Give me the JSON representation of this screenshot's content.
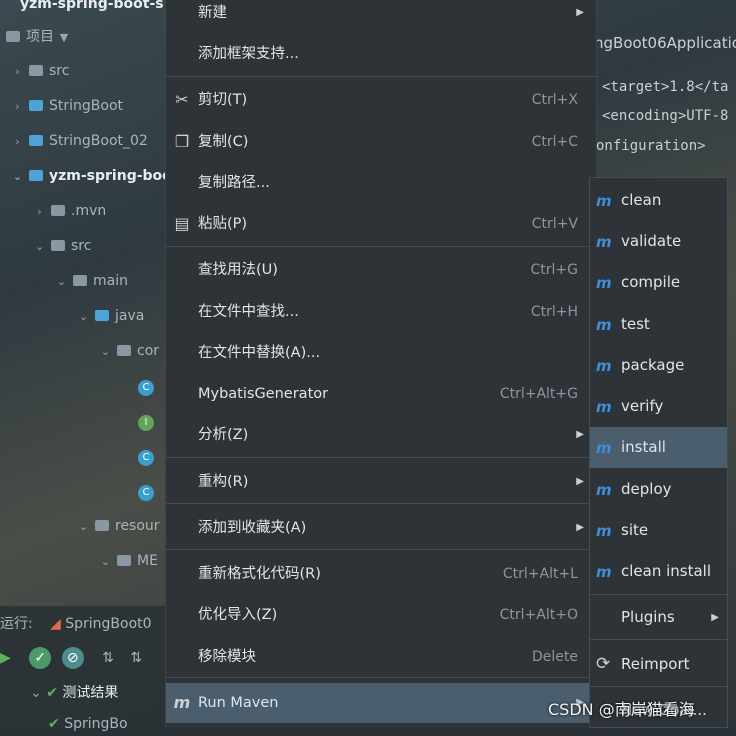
{
  "project_tree": {
    "header_title": "yzm-spring-boot-s",
    "view_label": "项目",
    "items": [
      "src",
      "StringBoot",
      "StringBoot_02",
      "yzm-spring-boo",
      ".mvn",
      "src",
      "main",
      "java",
      "cor",
      "resour",
      "ME"
    ],
    "run_label": "运行:",
    "run_config": "SpringBoot0",
    "test_results": "测试结果",
    "next_row": "SpringBo"
  },
  "editor": {
    "tab_title": "ngBoot06Applicatio",
    "lines": [
      "<target>1.8</ta",
      "<encoding>UTF-8",
      "onfiguration>"
    ]
  },
  "context_menu": {
    "items": [
      {
        "label": "新建",
        "shortcut": "",
        "submenu": true,
        "icon": ""
      },
      {
        "label": "添加框架支持...",
        "shortcut": "",
        "submenu": false,
        "icon": ""
      },
      {
        "label": "剪切(T)",
        "shortcut": "Ctrl+X",
        "submenu": false,
        "icon": "scissors-icon"
      },
      {
        "label": "复制(C)",
        "shortcut": "Ctrl+C",
        "submenu": false,
        "icon": "copy-icon"
      },
      {
        "label": "复制路径...",
        "shortcut": "",
        "submenu": false,
        "icon": ""
      },
      {
        "label": "粘贴(P)",
        "shortcut": "Ctrl+V",
        "submenu": false,
        "icon": "paste-icon"
      },
      {
        "label": "查找用法(U)",
        "shortcut": "Ctrl+G",
        "submenu": false,
        "icon": ""
      },
      {
        "label": "在文件中查找...",
        "shortcut": "Ctrl+H",
        "submenu": false,
        "icon": ""
      },
      {
        "label": "在文件中替换(A)...",
        "shortcut": "",
        "submenu": false,
        "icon": ""
      },
      {
        "label": "MybatisGenerator",
        "shortcut": "Ctrl+Alt+G",
        "submenu": false,
        "icon": ""
      },
      {
        "label": "分析(Z)",
        "shortcut": "",
        "submenu": true,
        "icon": ""
      },
      {
        "label": "重构(R)",
        "shortcut": "",
        "submenu": true,
        "icon": ""
      },
      {
        "label": "添加到收藏夹(A)",
        "shortcut": "",
        "submenu": true,
        "icon": ""
      },
      {
        "label": "重新格式化代码(R)",
        "shortcut": "Ctrl+Alt+L",
        "submenu": false,
        "icon": ""
      },
      {
        "label": "优化导入(Z)",
        "shortcut": "Ctrl+Alt+O",
        "submenu": false,
        "icon": ""
      },
      {
        "label": "移除模块",
        "shortcut": "Delete",
        "submenu": false,
        "icon": ""
      },
      {
        "label": "Run Maven",
        "shortcut": "",
        "submenu": true,
        "icon": "maven-icon",
        "active": true
      }
    ]
  },
  "maven_submenu": {
    "items": [
      {
        "label": "clean",
        "icon": "maven-icon"
      },
      {
        "label": "validate",
        "icon": "maven-icon"
      },
      {
        "label": "compile",
        "icon": "maven-icon"
      },
      {
        "label": "test",
        "icon": "maven-icon"
      },
      {
        "label": "package",
        "icon": "maven-icon"
      },
      {
        "label": "verify",
        "icon": "maven-icon"
      },
      {
        "label": "install",
        "icon": "maven-icon",
        "active": true
      },
      {
        "label": "deploy",
        "icon": "maven-icon"
      },
      {
        "label": "site",
        "icon": "maven-icon"
      },
      {
        "label": "clean install",
        "icon": "maven-icon"
      },
      {
        "label": "Plugins",
        "icon": "",
        "submenu": true
      },
      {
        "label": "Reimport",
        "icon": "refresh-icon"
      },
      {
        "label": "New Goal...",
        "icon": ""
      }
    ]
  },
  "watermark": "CSDN @南岸猫看海",
  "colors": {
    "menu_bg": "#2e3338",
    "highlight": "#4b5e6d",
    "maven_blue": "#3e8ed8"
  }
}
